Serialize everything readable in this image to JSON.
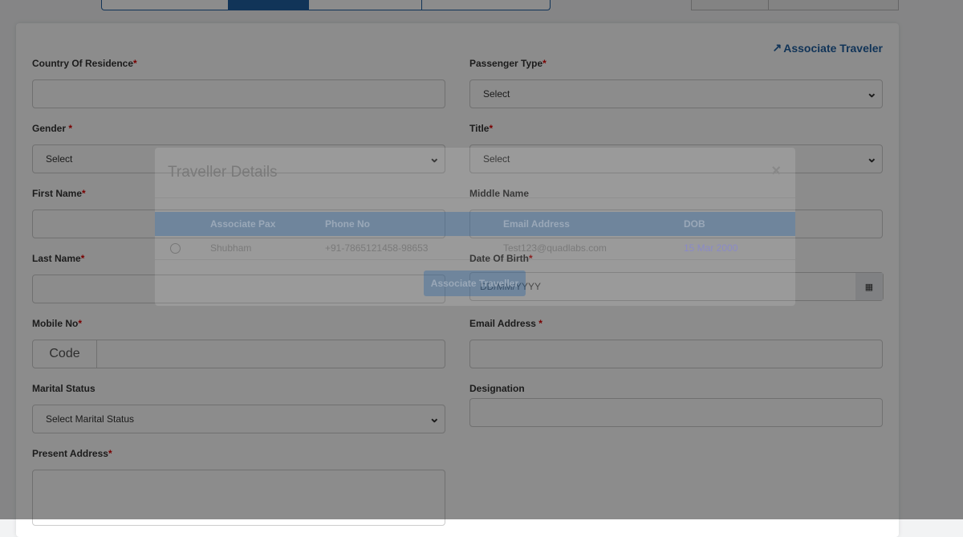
{
  "header": {
    "associate_link": "Associate Traveler"
  },
  "form": {
    "country": {
      "label": "Country Of Residence",
      "req": "*",
      "value": ""
    },
    "pax_type": {
      "label": "Passenger Type",
      "req": "*",
      "value": "Select"
    },
    "gender": {
      "label": "Gender ",
      "req": "*",
      "value": "Select"
    },
    "title": {
      "label": "Title",
      "req": "*",
      "value": "Select"
    },
    "first_name": {
      "label": "First Name",
      "req": "*"
    },
    "middle_name": {
      "label": "Middle Name"
    },
    "last_name": {
      "label": "Last Name",
      "req": "*"
    },
    "dob": {
      "label": "Date Of Birth",
      "req": "*",
      "placeholder": "DD/MM/YYYY"
    },
    "mobile": {
      "label": "Mobile No",
      "req": "*",
      "code": "Code"
    },
    "email": {
      "label": "Email Address ",
      "req": "*"
    },
    "marital": {
      "label": "Marital Status",
      "value": "Select Marital Status"
    },
    "designation": {
      "label": "Designation"
    },
    "address": {
      "label": "Present Address",
      "req": "*"
    }
  },
  "modal": {
    "title": "Traveller Details",
    "close": "×",
    "headers": [
      "Associate Pax",
      "Phone No",
      "Email Address",
      "DOB"
    ],
    "rows": [
      {
        "name": "Shubham",
        "phone": "+91-7865121458-98653",
        "email": "Test123@quadlabs.com",
        "dob": "15 Mar 2000"
      }
    ],
    "button": "Associate Traveller"
  }
}
